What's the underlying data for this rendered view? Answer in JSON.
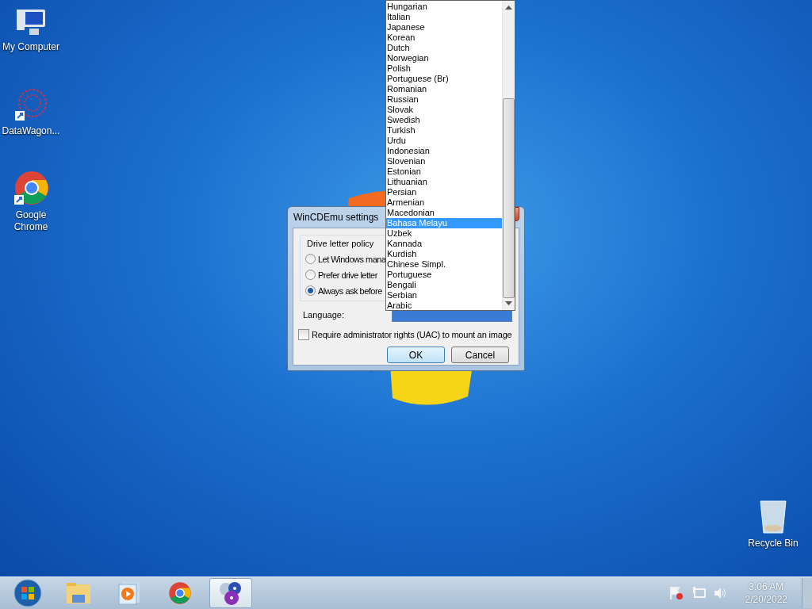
{
  "desktop_icons": [
    {
      "label": "My Computer",
      "kind": "computer"
    },
    {
      "label": "DataWagon...",
      "kind": "datawagon"
    },
    {
      "label": "Google Chrome",
      "kind": "chrome"
    },
    {
      "label": "Recycle Bin",
      "kind": "recycle"
    }
  ],
  "dialog": {
    "title": "WinCDEmu settings",
    "group_label": "Drive letter policy",
    "radios": [
      {
        "label": "Let Windows mana",
        "selected": false
      },
      {
        "label": "Prefer drive letter",
        "selected": false
      },
      {
        "label": "Always ask before",
        "selected": true
      }
    ],
    "language_label": "Language:",
    "uac_checkbox": {
      "label": "Require administrator rights (UAC) to mount an image",
      "checked": false
    },
    "buttons": [
      {
        "label": "OK",
        "kind": "default"
      },
      {
        "label": "Cancel",
        "kind": "normal"
      }
    ]
  },
  "language_list": {
    "items": [
      {
        "label": "Hungarian",
        "selected": false
      },
      {
        "label": "Italian",
        "selected": false
      },
      {
        "label": "Japanese",
        "selected": false
      },
      {
        "label": "Korean",
        "selected": false
      },
      {
        "label": "Dutch",
        "selected": false
      },
      {
        "label": "Norwegian",
        "selected": false
      },
      {
        "label": "Polish",
        "selected": false
      },
      {
        "label": "Portuguese (Br)",
        "selected": false
      },
      {
        "label": "Romanian",
        "selected": false
      },
      {
        "label": "Russian",
        "selected": false
      },
      {
        "label": "Slovak",
        "selected": false
      },
      {
        "label": "Swedish",
        "selected": false
      },
      {
        "label": "Turkish",
        "selected": false
      },
      {
        "label": "Urdu",
        "selected": false
      },
      {
        "label": "Indonesian",
        "selected": false
      },
      {
        "label": "Slovenian",
        "selected": false
      },
      {
        "label": "Estonian",
        "selected": false
      },
      {
        "label": "Lithuanian",
        "selected": false
      },
      {
        "label": "Persian",
        "selected": false
      },
      {
        "label": "Armenian",
        "selected": false
      },
      {
        "label": "Macedonian",
        "selected": false
      },
      {
        "label": "Bahasa Melayu",
        "selected": true
      },
      {
        "label": "Uzbek",
        "selected": false
      },
      {
        "label": "Kannada",
        "selected": false
      },
      {
        "label": "Kurdish",
        "selected": false
      },
      {
        "label": "Chinese Simpl.",
        "selected": false
      },
      {
        "label": "Portuguese",
        "selected": false
      },
      {
        "label": "Bengali",
        "selected": false
      },
      {
        "label": "Serbian",
        "selected": false
      },
      {
        "label": "Arabic",
        "selected": false
      }
    ]
  },
  "taskbar": {
    "items": [
      {
        "kind": "start",
        "active": false
      },
      {
        "kind": "explorer",
        "active": false
      },
      {
        "kind": "media",
        "active": false
      },
      {
        "kind": "chrome",
        "active": false
      },
      {
        "kind": "discs",
        "active": true
      }
    ],
    "tray": {
      "time": "3:06 AM",
      "date": "2/20/2022"
    }
  }
}
